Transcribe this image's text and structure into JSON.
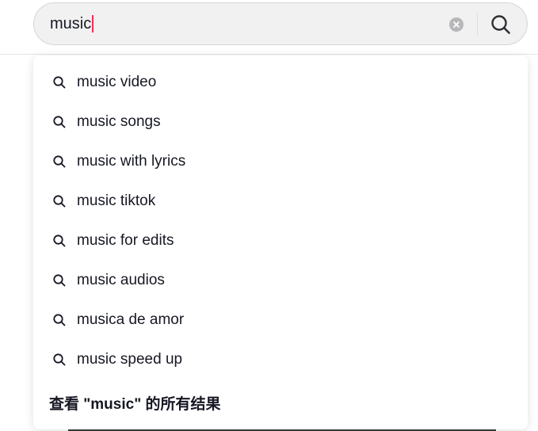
{
  "search": {
    "query": "music",
    "clear_icon": "clear-x-circle-icon",
    "submit_icon": "search-icon"
  },
  "suggestions": [
    {
      "label": "music video",
      "icon": "search-icon"
    },
    {
      "label": "music songs",
      "icon": "search-icon"
    },
    {
      "label": "music with lyrics",
      "icon": "search-icon"
    },
    {
      "label": "music tiktok",
      "icon": "search-icon"
    },
    {
      "label": "music for edits",
      "icon": "search-icon"
    },
    {
      "label": "music audios",
      "icon": "search-icon"
    },
    {
      "label": "musica de amor",
      "icon": "search-icon"
    },
    {
      "label": "music speed up",
      "icon": "search-icon"
    }
  ],
  "view_all_label": "查看 \"music\" 的所有结果",
  "colors": {
    "caret": "#fe2c55",
    "text": "#161823",
    "search_bg": "#f1f1f2"
  }
}
